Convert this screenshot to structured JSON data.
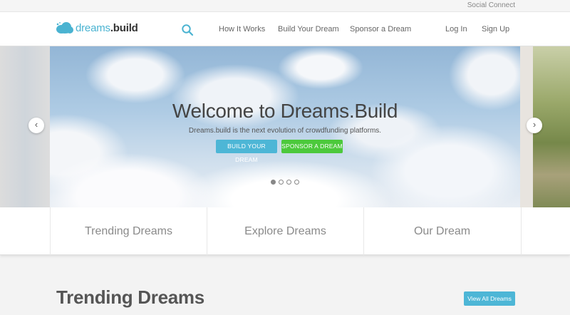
{
  "topbar": {
    "social_label": "Social Connect"
  },
  "brand": {
    "name_part1": "dreams",
    "name_part2": ".build",
    "accent_color": "#4ab3d1",
    "icon": "cloud-logo-icon"
  },
  "nav": {
    "search_icon": "search-icon",
    "links": [
      "How It Works",
      "Build Your Dream",
      "Sponsor a Dream"
    ],
    "login": "Log In",
    "signup": "Sign Up"
  },
  "hero": {
    "title": "Welcome to Dreams.Build",
    "subtitle": "Dreams.build is the next evolution of crowdfunding platforms.",
    "primary_button": "BUILD YOUR DREAM",
    "secondary_button": "SPONSOR A DREAM",
    "primary_color": "#4db6d6",
    "secondary_color": "#4cc93c",
    "prev_icon": "chevron-left-icon",
    "next_icon": "chevron-right-icon",
    "slide_count": 4,
    "active_slide": 1
  },
  "tiles": [
    "Trending Dreams",
    "Explore Dreams",
    "Our Dream"
  ],
  "section": {
    "title": "Trending Dreams",
    "view_all": "View All Dreams"
  }
}
